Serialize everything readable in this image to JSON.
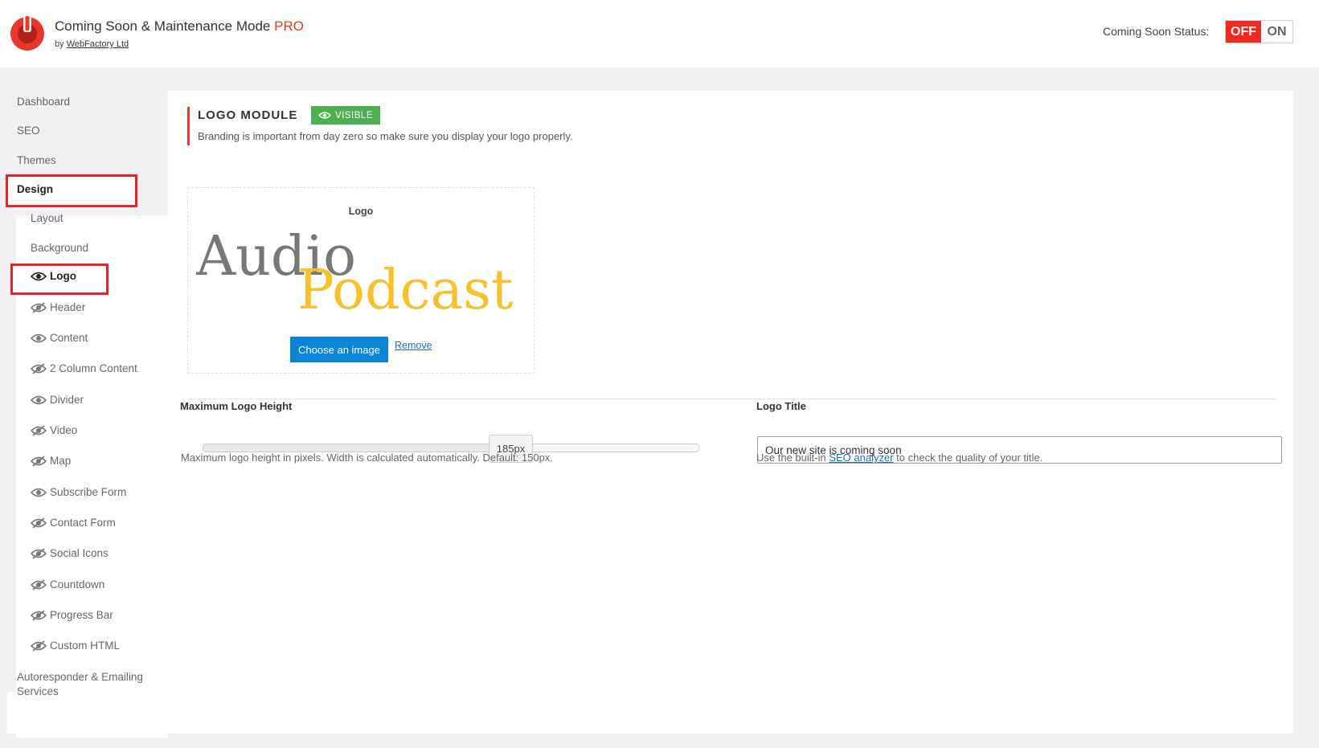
{
  "header": {
    "title": "Coming Soon & Maintenance Mode",
    "pro_label": "PRO",
    "byline_prefix": "by",
    "byline_link": "WebFactory Ltd",
    "status_label": "Coming Soon Status:",
    "toggle_off": "OFF",
    "toggle_on": "ON"
  },
  "sidebar": {
    "dashboard": "Dashboard",
    "seo": "SEO",
    "themes": "Themes",
    "design": "Design",
    "layout": "Layout",
    "background": "Background",
    "modules": [
      {
        "label": "Logo",
        "icon": "eye-icon"
      },
      {
        "label": "Header",
        "icon": "eye-slash-icon"
      },
      {
        "label": "Content",
        "icon": "eye-icon"
      },
      {
        "label": "2 Column Content",
        "icon": "eye-slash-icon"
      },
      {
        "label": "Divider",
        "icon": "eye-icon"
      },
      {
        "label": "Video",
        "icon": "eye-slash-icon"
      },
      {
        "label": "Map",
        "icon": "eye-slash-icon"
      },
      {
        "label": "Subscribe Form",
        "icon": "eye-icon"
      },
      {
        "label": "Contact Form",
        "icon": "eye-slash-icon"
      },
      {
        "label": "Social Icons",
        "icon": "eye-slash-icon"
      },
      {
        "label": "Countdown",
        "icon": "eye-slash-icon"
      },
      {
        "label": "Progress Bar",
        "icon": "eye-slash-icon"
      },
      {
        "label": "Custom HTML",
        "icon": "eye-slash-icon"
      }
    ],
    "autoresponder": "Autoresponder & Emailing Services"
  },
  "module": {
    "title": "LOGO MODULE",
    "badge": "VISIBLE",
    "description": "Branding is important from day zero so make sure you display your logo properly."
  },
  "logo_field": {
    "label": "Logo",
    "choose_button": "Choose an image",
    "remove_link": "Remove",
    "art_word1": "Audio",
    "art_word2": "Podcast"
  },
  "max_height": {
    "label": "Maximum Logo Height",
    "value_label": "185px",
    "value_fraction": 0.62,
    "help": "Maximum logo height in pixels. Width is calculated automatically. Default: 150px."
  },
  "logo_title": {
    "label": "Logo Title",
    "value": "Our new site is coming soon",
    "help_prefix": "Use the built-in",
    "help_link": "SEO analyzer",
    "help_suffix": "to check the quality of your title."
  },
  "colors": {
    "accent_red": "#e8372b",
    "visible_green": "#4caf50",
    "button_blue": "#0a84d6",
    "podcast_yellow": "#f6c12a"
  }
}
